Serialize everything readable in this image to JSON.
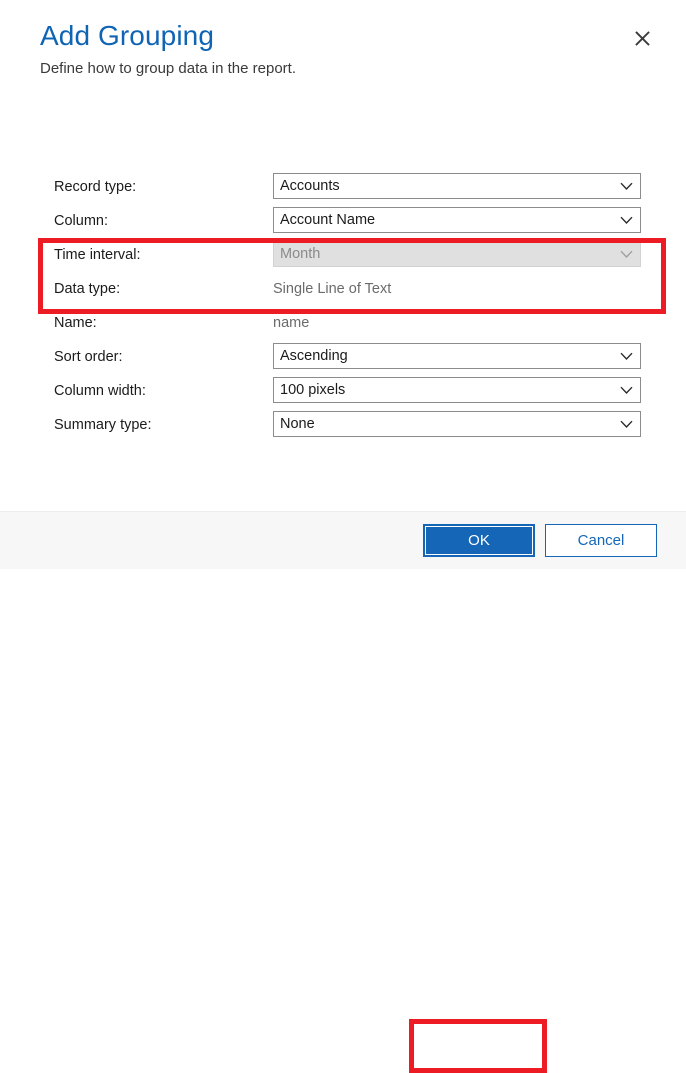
{
  "dialog": {
    "title": "Add Grouping",
    "subtitle": "Define how to group data in the report.",
    "close_icon": "close-icon"
  },
  "colors": {
    "title_blue": "#0f64b4",
    "accent_blue": "#1566b7",
    "highlight_red": "#ed1c24",
    "required_star_red": "#e81123",
    "footer_bg": "#f7f7f7",
    "disabled_bg": "#e0e0e0"
  },
  "form": {
    "required_marker": "*",
    "rows": [
      {
        "label": "Record type:",
        "required": true,
        "control": "combo",
        "value": "Accounts",
        "disabled": false,
        "name": "record-type"
      },
      {
        "label": "Column:",
        "required": true,
        "control": "combo",
        "value": "Account Name",
        "disabled": false,
        "name": "column"
      },
      {
        "label": "Time interval:",
        "required": false,
        "control": "combo",
        "value": "Month",
        "disabled": true,
        "name": "time-interval"
      },
      {
        "label": "Data type:",
        "required": false,
        "control": "text",
        "value": "Single Line of Text",
        "disabled": false,
        "name": "data-type"
      },
      {
        "label": "Name:",
        "required": false,
        "control": "text",
        "value": "name",
        "disabled": false,
        "name": "field-name"
      },
      {
        "label": "Sort order:",
        "required": false,
        "control": "combo",
        "value": "Ascending",
        "disabled": false,
        "name": "sort-order"
      },
      {
        "label": "Column width:",
        "required": true,
        "control": "combo",
        "value": "100 pixels",
        "disabled": false,
        "name": "column-width"
      },
      {
        "label": "Summary type:",
        "required": false,
        "control": "combo",
        "value": "None",
        "disabled": false,
        "name": "summary-type"
      }
    ]
  },
  "footer": {
    "ok_label": "OK",
    "cancel_label": "Cancel"
  },
  "annotations": [
    {
      "name": "highlight-required-fields",
      "target": "record-type-and-column-rows"
    },
    {
      "name": "highlight-ok-button",
      "target": "ok-button"
    }
  ]
}
